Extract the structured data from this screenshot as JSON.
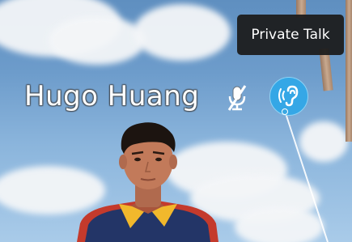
{
  "tooltip": {
    "text": "Private Talk"
  },
  "user": {
    "name": "Hugo Huang"
  },
  "icons": {
    "mic": "microphone-muted-icon",
    "private_talk": "ear-sound-waves-icon"
  },
  "colors": {
    "sky": "#6d9ccb",
    "private_talk_button": "#35a7e6",
    "tooltip_background": "#1c1c1c",
    "name_text": "#ffffff"
  }
}
